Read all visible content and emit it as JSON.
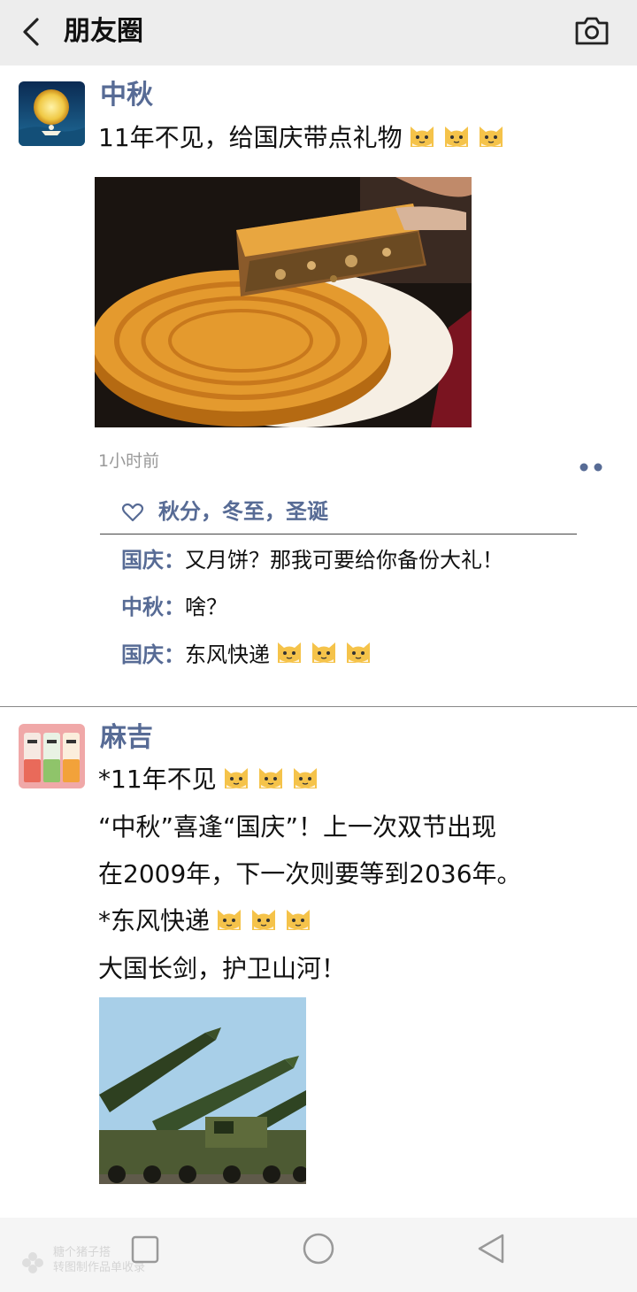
{
  "header": {
    "title": "朋友圈",
    "back_icon": "chevron-left-icon",
    "camera_icon": "camera-icon"
  },
  "posts": [
    {
      "author": "中秋",
      "avatar": "moon-festival-avatar",
      "text_lines": [
        "11年不见，给国庆带点礼物"
      ],
      "emoji": "cat-face-emoji",
      "image": "mooncake-photo",
      "time": "1小时前",
      "likes": "秋分，冬至，圣诞",
      "comments": [
        {
          "name": "国庆：",
          "text": "又月饼？那我可要给你备份大礼！"
        },
        {
          "name": "中秋：",
          "text": "啥？"
        },
        {
          "name": "国庆：",
          "text": "东风快递"
        }
      ]
    },
    {
      "author": "麻吉",
      "avatar": "drink-cans-avatar",
      "text_lines": [
        "*11年不见",
        "“中秋”喜逢“国庆”！上一次双节出现",
        "在2009年，下一次则要等到2036年。",
        "*东风快递",
        "大国长剑，护卫山河！"
      ],
      "image": "missile-launchers-photo"
    }
  ],
  "navbar": {
    "buttons": [
      "square-recent-icon",
      "circle-home-icon",
      "triangle-back-icon"
    ],
    "watermark_line1": "糖个猪子搭",
    "watermark_line2": "转图制作品单收录"
  },
  "colors": {
    "link": "#576b95",
    "header_bg": "#ededed",
    "time": "#999999"
  }
}
